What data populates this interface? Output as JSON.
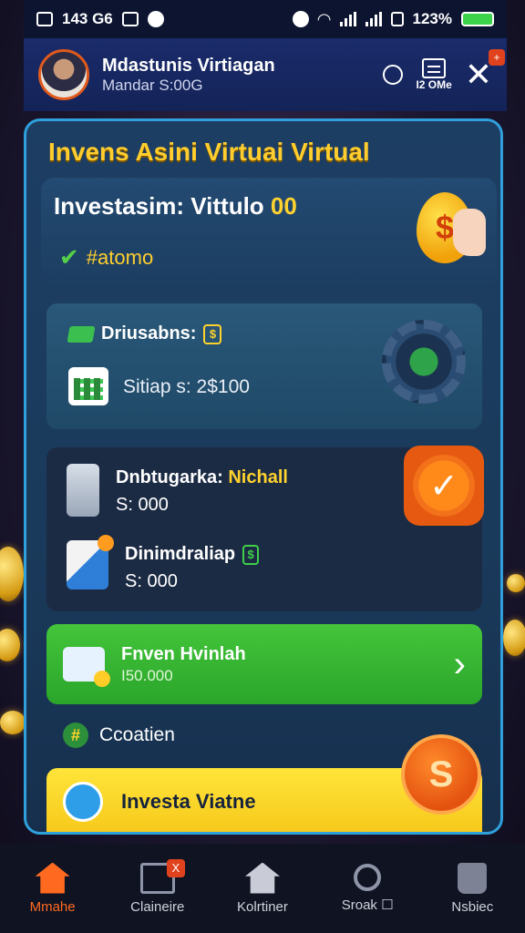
{
  "status_bar": {
    "left_text": "143 G6",
    "right_text": "123%"
  },
  "header": {
    "title": "Mdastunis Virtiagan",
    "subtitle": "Mandar S:00G",
    "doc_label": "I2 OMe",
    "badge": "+"
  },
  "hero": {
    "title": "Invens Asini Virtuai Virtual"
  },
  "investment": {
    "title": "Investasim: Vittulo",
    "title_suffix": "00",
    "status": "#atomo"
  },
  "dividends": {
    "title": "Driusabns:",
    "setup_text": "Sitiap s: 2$100"
  },
  "wallet": {
    "row1_title": "Dnbtugarka:",
    "row1_title_highlight": "Nichall",
    "row1_amount": "S: 000",
    "row2_title": "Dinimdraliap",
    "row2_amount": "S: 000"
  },
  "cta_green": {
    "title": "Fnven Hvinlah",
    "subtitle": "I50.000"
  },
  "creation": {
    "label": "Ccoatien"
  },
  "cta_yellow": {
    "label": "Investa Viatne"
  },
  "fab": {
    "symbol": "S"
  },
  "bottom_nav": {
    "items": [
      {
        "label": "Mmahe",
        "icon": "home-icon",
        "active": true
      },
      {
        "label": "Claineire",
        "icon": "list-icon",
        "badge": "X"
      },
      {
        "label": "Kolrtiner",
        "icon": "house-icon"
      },
      {
        "label": "Sroak ☐",
        "icon": "magnifier-icon"
      },
      {
        "label": "Nsbiec",
        "icon": "bag-icon"
      }
    ]
  },
  "colors": {
    "accent_orange": "#ff6a20",
    "brand_yellow": "#ffd22e",
    "cta_green": "#2aa52a",
    "header_blue": "#1a2b6b"
  }
}
